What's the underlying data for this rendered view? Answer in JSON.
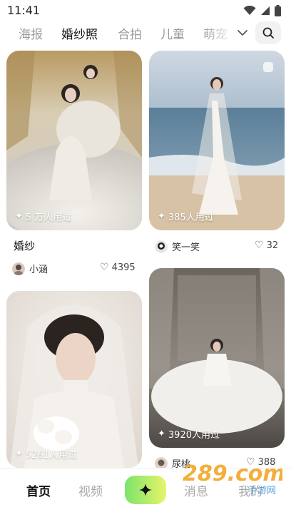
{
  "status_bar": {
    "time": "11:41"
  },
  "tabs": [
    {
      "label": "海报"
    },
    {
      "label": "婚纱照"
    },
    {
      "label": "合拍"
    },
    {
      "label": "儿童"
    },
    {
      "label": "萌宠"
    }
  ],
  "active_tab": "婚纱照",
  "feed": {
    "cards": [
      {
        "usage": "5 万人用过",
        "title": "婚纱",
        "author": "小涵",
        "likes": "4395"
      },
      {
        "usage": "385人用过",
        "title": "",
        "author": "笑一笑",
        "likes": "32"
      },
      {
        "usage": "5261人用过"
      },
      {
        "usage": "3920人用过",
        "author": "尿桃",
        "likes": "388"
      }
    ]
  },
  "bottom_nav": {
    "items": [
      {
        "label": "首页"
      },
      {
        "label": "视频"
      },
      {
        "label": "消息"
      },
      {
        "label": "我的"
      }
    ],
    "active": "首页"
  },
  "watermark": {
    "text": "289.com",
    "sub": "手游网"
  },
  "colors": {
    "accent_green": "#c9f56a",
    "create_gradient_start": "#7be36b",
    "create_gradient_end": "#e7f56a"
  }
}
